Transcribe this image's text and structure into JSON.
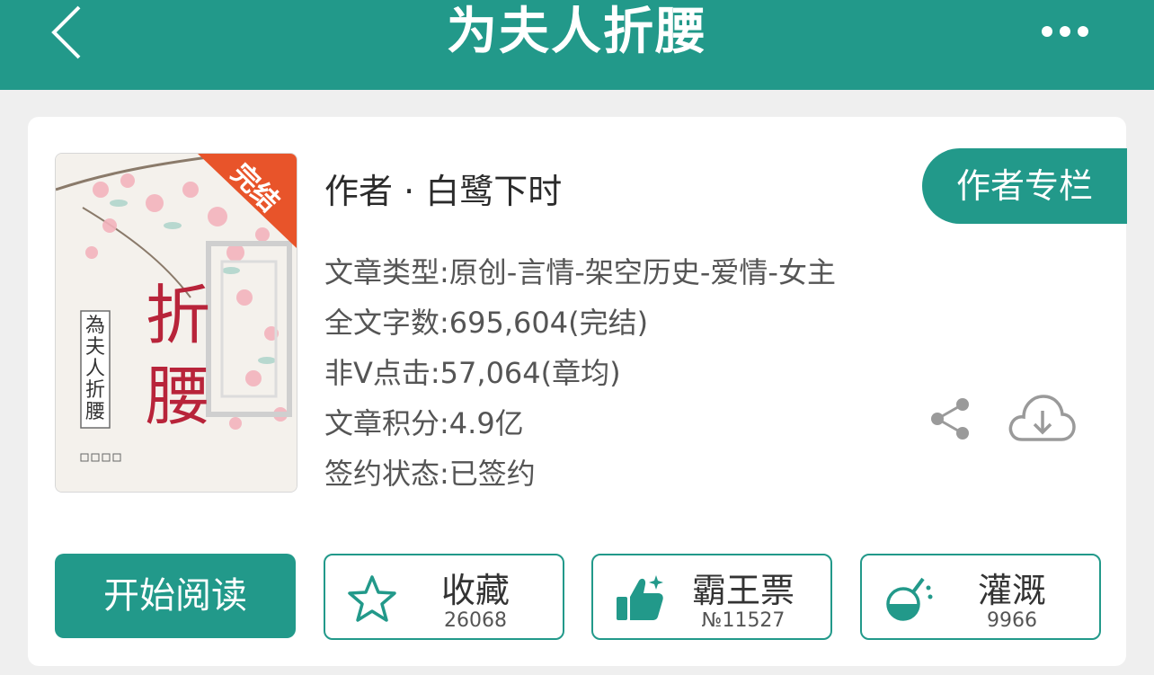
{
  "header": {
    "title": "为夫人折腰",
    "back_icon": "chevron-left-icon",
    "more_icon": "more-dots-icon",
    "bg_color": "#22998a"
  },
  "book": {
    "cover": {
      "badge": "完结",
      "title_big": "折腰",
      "title_vertical": "為夫人折腰"
    },
    "author": "作者 · 白鹭下时",
    "author_column_label": "作者专栏",
    "info": [
      "文章类型:原创-言情-架空历史-爱情-女主",
      "全文字数:695,604(完结)",
      "非Ⅴ点击:57,064(章均)",
      "文章积分:4.9亿",
      "签约状态:已签约"
    ]
  },
  "actions": {
    "read_label": "开始阅读",
    "favorite": {
      "label": "收藏",
      "count": "26068",
      "icon": "star-icon"
    },
    "ticket": {
      "label": "霸王票",
      "count": "№11527",
      "icon": "thumbs-up-icon"
    },
    "water": {
      "label": "灌溉",
      "count": "9966",
      "icon": "flask-icon"
    }
  },
  "icons": {
    "share": "share-icon",
    "download": "cloud-download-icon"
  }
}
